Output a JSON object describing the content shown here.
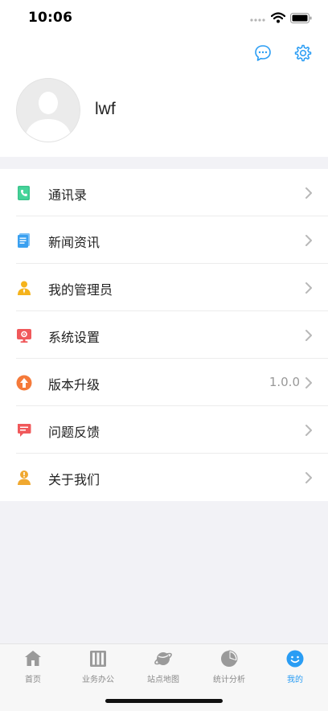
{
  "status_bar": {
    "time": "10:06"
  },
  "header": {
    "message_icon": "chat-bubble-icon",
    "settings_icon": "gear-icon",
    "username": "lwf",
    "accent_color": "#2a9df4"
  },
  "menu": {
    "items": [
      {
        "label": "通讯录",
        "value": "",
        "icon": "contacts-phone-icon",
        "color": "#3cc48c"
      },
      {
        "label": "新闻资讯",
        "value": "",
        "icon": "news-document-icon",
        "color": "#3aa0f0"
      },
      {
        "label": "我的管理员",
        "value": "",
        "icon": "admin-person-icon",
        "color": "#f5b31c"
      },
      {
        "label": "系统设置",
        "value": "",
        "icon": "system-monitor-icon",
        "color": "#f0595b"
      },
      {
        "label": "版本升级",
        "value": "1.0.0",
        "icon": "upgrade-arrow-icon",
        "color": "#f57a3a"
      },
      {
        "label": "问题反馈",
        "value": "",
        "icon": "feedback-chat-icon",
        "color": "#f0595b"
      },
      {
        "label": "关于我们",
        "value": "",
        "icon": "about-info-icon",
        "color": "#f0a830"
      }
    ]
  },
  "tabbar": {
    "tabs": [
      {
        "label": "首页",
        "icon": "home-icon",
        "active": false
      },
      {
        "label": "业务办公",
        "icon": "office-books-icon",
        "active": false
      },
      {
        "label": "站点地图",
        "icon": "planet-map-icon",
        "active": false
      },
      {
        "label": "统计分析",
        "icon": "pie-chart-icon",
        "active": false
      },
      {
        "label": "我的",
        "icon": "profile-face-icon",
        "active": true
      }
    ],
    "active_color": "#2a9df4",
    "inactive_color": "#8a8a8a"
  }
}
